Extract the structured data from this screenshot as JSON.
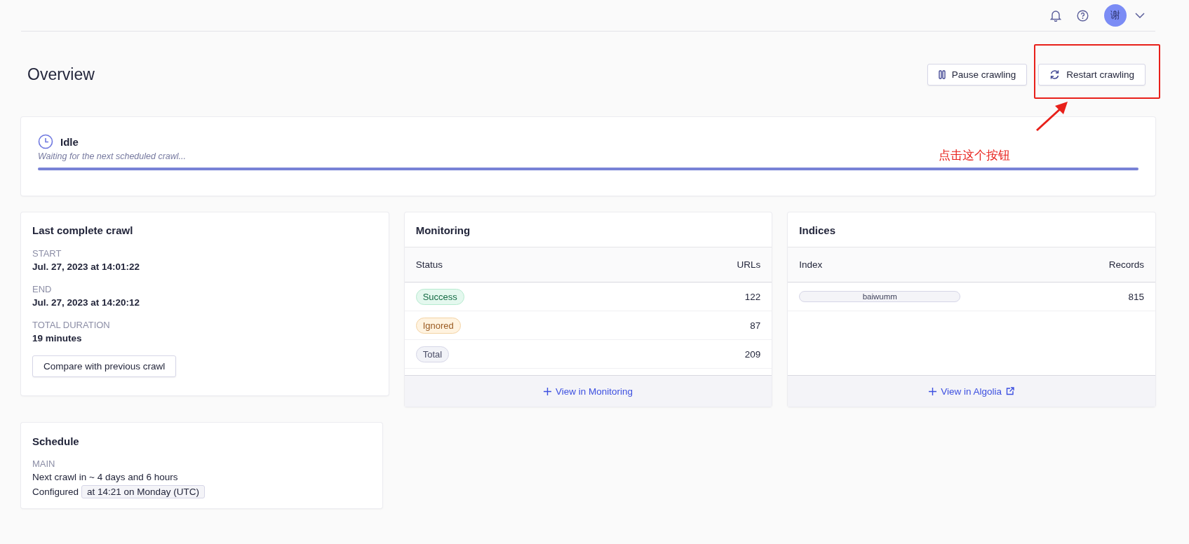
{
  "topbar": {
    "avatar": "谢"
  },
  "page": {
    "title": "Overview",
    "buttons": [
      {
        "kind": "pause",
        "label": "Pause crawling"
      },
      {
        "kind": "restart",
        "label": "Restart crawling"
      }
    ]
  },
  "status": {
    "title": "Idle",
    "subtitle": "Waiting for the next scheduled crawl...",
    "level": 1
  },
  "last_crawl": {
    "title": "Last complete crawl",
    "fields": [
      {
        "label": "START",
        "value": "Jul. 27, 2023 at 14:01:22"
      },
      {
        "label": "END",
        "value": "Jul. 27, 2023 at 14:20:12"
      },
      {
        "label": "TOTAL DURATION",
        "value": "19 minutes"
      }
    ],
    "button": "Compare with previous crawl"
  },
  "monitoring": {
    "title": "Monitoring",
    "columns": [
      "Status",
      "URLs"
    ],
    "rows": [
      {
        "kind": "success",
        "status": "Success",
        "urls": "122"
      },
      {
        "kind": "ignored",
        "status": "Ignored",
        "urls": "87"
      },
      {
        "kind": "total",
        "status": "Total",
        "urls": "209"
      }
    ],
    "link": "View in Monitoring"
  },
  "indices": {
    "title": "Indices",
    "columns": [
      "Index",
      "Records"
    ],
    "rows": [
      {
        "index": "baiwumm",
        "records": "815"
      }
    ],
    "link": "View in Algolia"
  },
  "schedule": {
    "title": "Schedule",
    "label": "MAIN",
    "next": "Next crawl in ~ 4 days and 6 hours",
    "configured_label": "Configured",
    "configured_value": "at 14:21 on Monday (UTC)"
  },
  "annotation": {
    "text": "点击这个按钮"
  }
}
